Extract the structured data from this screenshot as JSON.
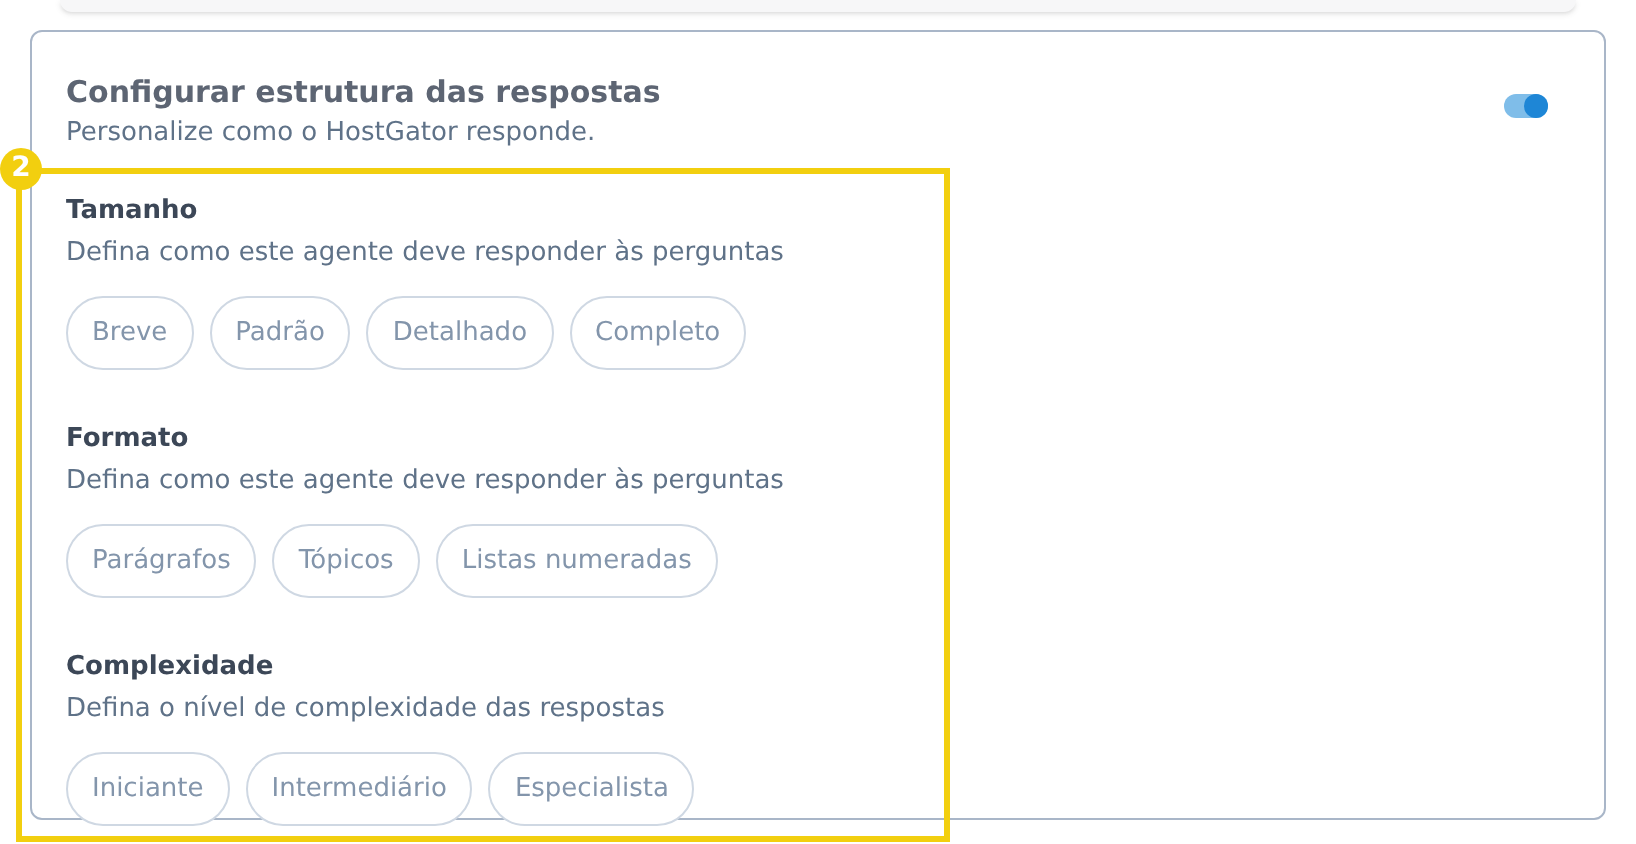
{
  "card": {
    "title": "Configurar estrutura das respostas",
    "subtitle": "Personalize como o HostGator responde.",
    "toggle": {
      "on": true
    }
  },
  "annotation": {
    "badge": "2"
  },
  "sections": [
    {
      "title": "Tamanho",
      "description": "Defina como este agente deve responder às perguntas",
      "options": [
        {
          "label": "Breve",
          "selected": false
        },
        {
          "label": "Padrão",
          "selected": false
        },
        {
          "label": "Detalhado",
          "selected": false
        },
        {
          "label": "Completo",
          "selected": false
        }
      ]
    },
    {
      "title": "Formato",
      "description": "Defina como este agente deve responder às perguntas",
      "options": [
        {
          "label": "Parágrafos",
          "selected": false
        },
        {
          "label": "Tópicos",
          "selected": false
        },
        {
          "label": "Listas numeradas",
          "selected": false
        }
      ]
    },
    {
      "title": "Complexidade",
      "description": "Defina o nível de complexidade das respostas",
      "options": [
        {
          "label": "Iniciante",
          "selected": false
        },
        {
          "label": "Intermediário",
          "selected": false
        },
        {
          "label": "Especialista",
          "selected": false
        }
      ]
    }
  ]
}
